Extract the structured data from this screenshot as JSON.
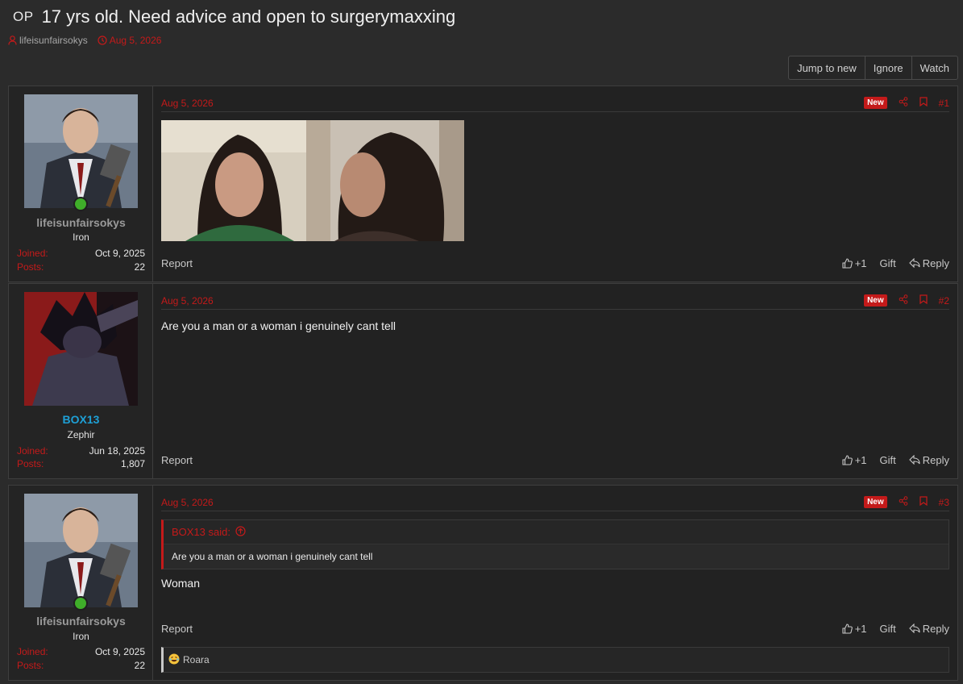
{
  "thread": {
    "op_label": "OP",
    "title": "17 yrs old. Need advice and open to surgerymaxxing",
    "author": "lifeisunfairsokys",
    "date": "Aug 5, 2026"
  },
  "thread_buttons": {
    "jump": "Jump to new",
    "ignore": "Ignore",
    "watch": "Watch"
  },
  "posts": [
    {
      "username": "lifeisunfairsokys",
      "rank": "Iron",
      "joined_label": "Joined:",
      "joined": "Oct 9, 2025",
      "posts_label": "Posts:",
      "posts": "22",
      "date": "Aug 5, 2026",
      "badge": "New",
      "number": "#1",
      "report": "Report",
      "like": "+1",
      "gift": "Gift",
      "reply": "Reply"
    },
    {
      "username": "BOX13",
      "rank": "Zephir",
      "joined_label": "Joined:",
      "joined": "Jun 18, 2025",
      "posts_label": "Posts:",
      "posts": "1,807",
      "date": "Aug 5, 2026",
      "badge": "New",
      "number": "#2",
      "text": "Are you a man or a woman i genuinely cant tell",
      "report": "Report",
      "like": "+1",
      "gift": "Gift",
      "reply": "Reply"
    },
    {
      "username": "lifeisunfairsokys",
      "rank": "Iron",
      "joined_label": "Joined:",
      "joined": "Oct 9, 2025",
      "posts_label": "Posts:",
      "posts": "22",
      "date": "Aug 5, 2026",
      "badge": "New",
      "number": "#3",
      "quote_author": "BOX13 said:",
      "quote_text": "Are you a man or a woman i genuinely cant tell",
      "text": "Woman",
      "report": "Report",
      "like": "+1",
      "gift": "Gift",
      "reply": "Reply",
      "reaction_user": "Roara"
    }
  ],
  "colors": {
    "accent": "#c41a1a",
    "background": "#2b2b2b",
    "username_blue": "#1ea0d6",
    "online": "#3fae2a"
  }
}
